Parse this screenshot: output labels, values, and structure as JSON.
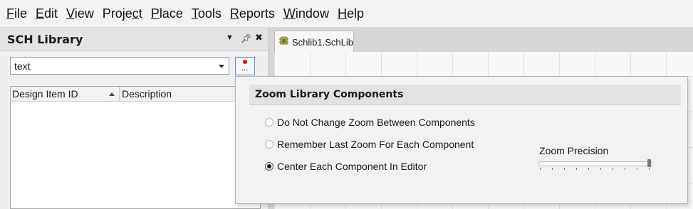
{
  "menu": [
    {
      "pre": "",
      "ul": "F",
      "post": "ile"
    },
    {
      "pre": "",
      "ul": "E",
      "post": "dit"
    },
    {
      "pre": "",
      "ul": "V",
      "post": "iew"
    },
    {
      "pre": "Proje",
      "ul": "c",
      "post": "t"
    },
    {
      "pre": "",
      "ul": "P",
      "post": "lace"
    },
    {
      "pre": "",
      "ul": "T",
      "post": "ools"
    },
    {
      "pre": "",
      "ul": "R",
      "post": "eports"
    },
    {
      "pre": "",
      "ul": "W",
      "post": "indow"
    },
    {
      "pre": "",
      "ul": "H",
      "post": "elp"
    }
  ],
  "panel": {
    "title": "SCH Library",
    "filter_value": "text",
    "options_button_dots": "...",
    "columns": [
      "Design Item ID",
      "Description"
    ]
  },
  "document": {
    "tab_label": "Schlib1.SchLib"
  },
  "popup": {
    "title": "Zoom Library Components",
    "options": [
      {
        "label": "Do Not Change Zoom Between Components",
        "checked": false
      },
      {
        "label": "Remember Last Zoom For Each Component",
        "checked": false
      },
      {
        "label": "Center Each Component In Editor",
        "checked": true
      }
    ],
    "zoom_precision_label": "Zoom Precision",
    "zoom_precision_value": 1.0
  },
  "colors": {
    "options_button_border": "#5a8fc9",
    "indicator_dot": "#e01818"
  }
}
